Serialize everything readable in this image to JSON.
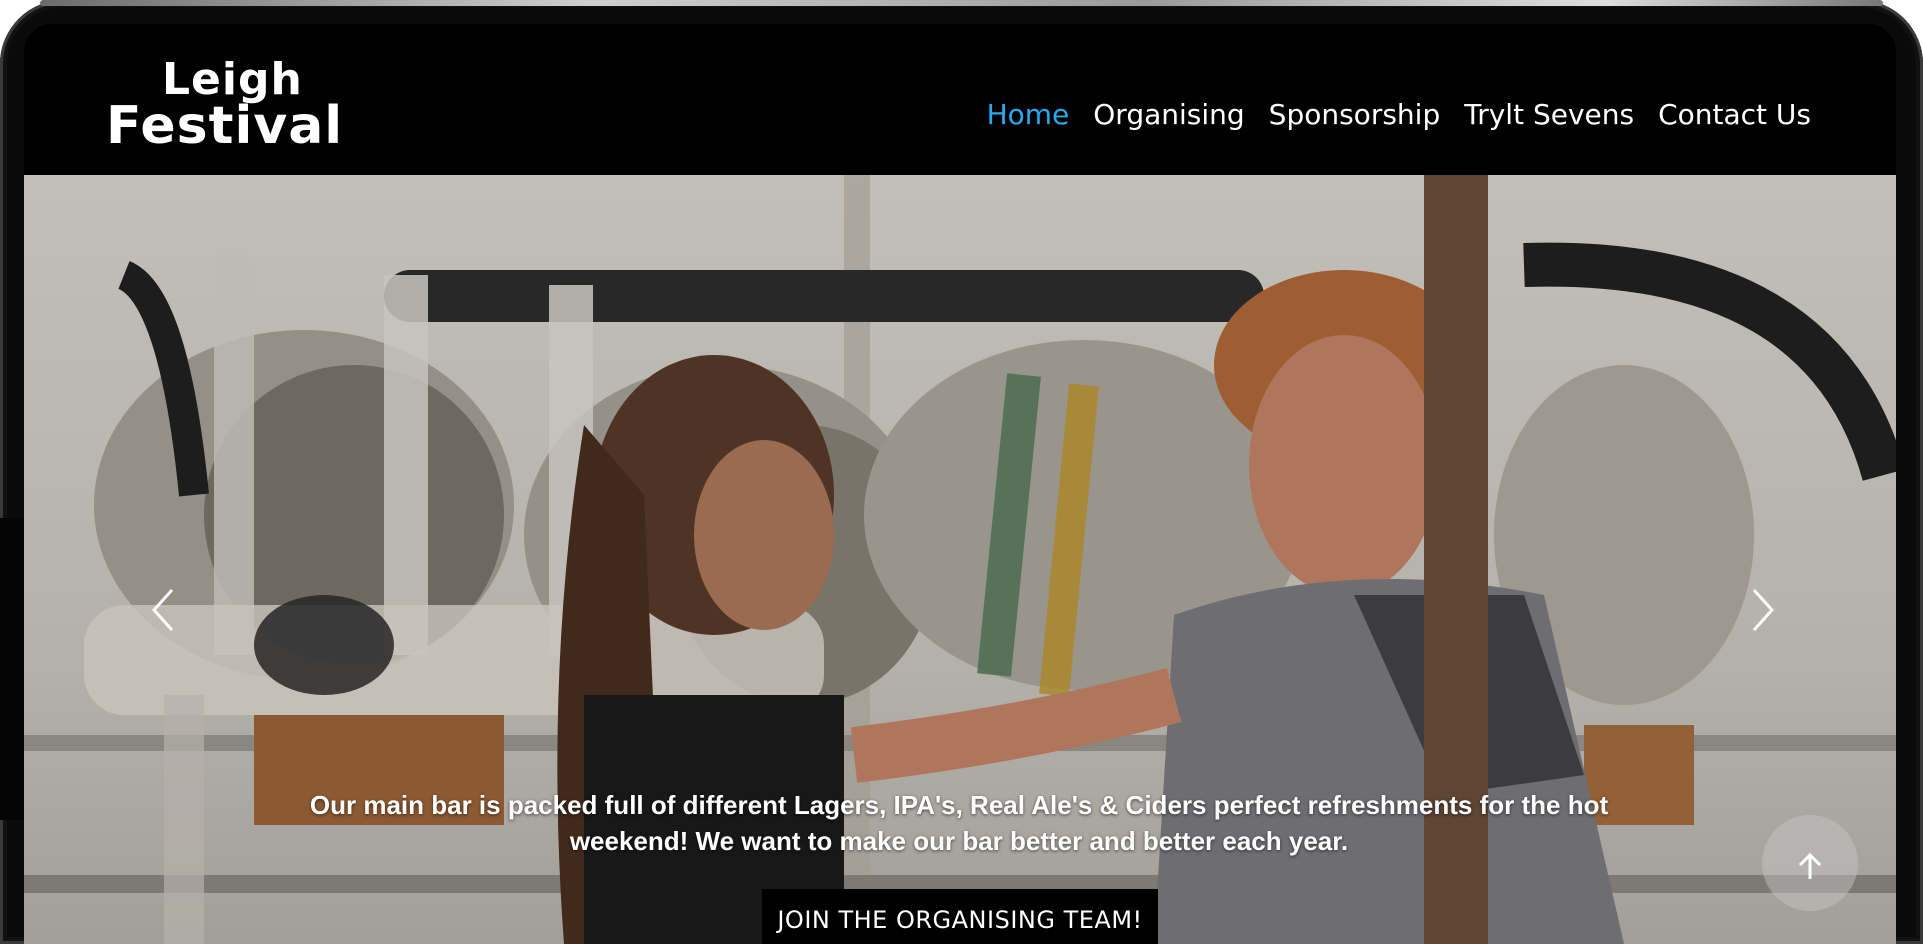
{
  "site": {
    "logo_line1": "Leigh",
    "logo_line2": "Festival"
  },
  "nav": {
    "items": [
      {
        "label": "Home",
        "active": true
      },
      {
        "label": "Organising",
        "active": false
      },
      {
        "label": "Sponsorship",
        "active": false
      },
      {
        "label": "Trylt Sevens",
        "active": false
      },
      {
        "label": "Contact Us",
        "active": false
      }
    ]
  },
  "hero": {
    "caption": "Our main bar is packed full of different Lagers, IPA's, Real Ale's & Ciders perfect refreshments for the hot weekend! We want to make our bar better and better each year.",
    "cta_label": "JOIN THE ORGANISING TEAM!",
    "prev_icon": "chevron-left-icon",
    "next_icon": "chevron-right-icon",
    "back_to_top_icon": "arrow-up-icon"
  },
  "colors": {
    "header_bg": "#000000",
    "nav_active": "#2aa8ec",
    "nav_text": "#ffffff",
    "cta_bg": "#000000"
  }
}
